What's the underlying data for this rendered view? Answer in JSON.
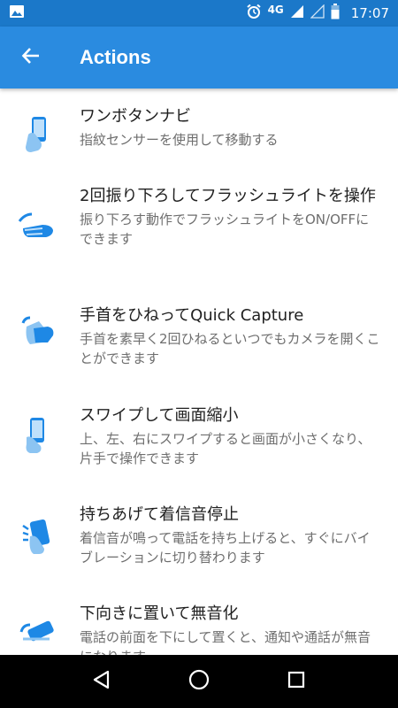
{
  "status_bar": {
    "network": "4G",
    "time": "17:07",
    "icons": [
      "image-notification-icon",
      "alarm-icon",
      "signal-icon",
      "signal-empty-icon",
      "battery-icon"
    ]
  },
  "app_bar": {
    "title": "Actions",
    "back_icon": "arrow-back-icon"
  },
  "actions": [
    {
      "icon": "one-button-nav-icon",
      "title": "ワンボタンナビ",
      "description": "指紋センサーを使用して移動する"
    },
    {
      "icon": "chop-flashlight-icon",
      "title": "2回振り下ろしてフラッシュライトを操作",
      "description": "振り下ろす動作でフラッシュライトをON/OFFにできます"
    },
    {
      "icon": "twist-camera-icon",
      "title": "手首をひねってQuick Capture",
      "description": "手首を素早く2回ひねるといつでもカメラを開くことができます"
    },
    {
      "icon": "swipe-shrink-icon",
      "title": "スワイプして画面縮小",
      "description": "上、左、右にスワイプすると画面が小さくなり、片手で操作できます"
    },
    {
      "icon": "lift-to-silence-icon",
      "title": "持ちあげて着信音停止",
      "description": "着信音が鳴って電話を持ち上げると、すぐにバイブレーションに切り替わります"
    },
    {
      "icon": "flip-to-mute-icon",
      "title": "下向きに置いて無音化",
      "description": "電話の前面を下にして置くと、通知や通話が無音になります"
    }
  ],
  "nav_bar": {
    "icons": [
      "nav-back-icon",
      "nav-home-icon",
      "nav-recents-icon"
    ]
  },
  "colors": {
    "status_bar": "#1b78c9",
    "app_bar": "#2a8be0",
    "icon_primary": "#1e88e5",
    "icon_light": "#8cc4f2"
  }
}
